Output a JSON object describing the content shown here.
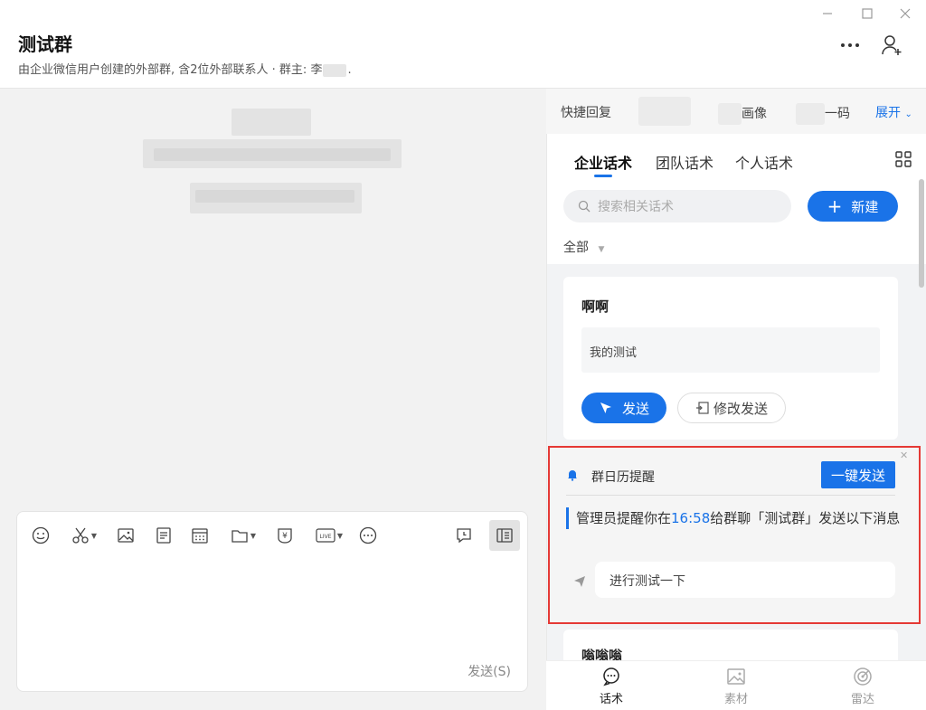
{
  "window": {
    "minimize_icon": "minimize-icon",
    "maximize_icon": "maximize-icon",
    "close_icon": "close-icon"
  },
  "header": {
    "title": "测试群",
    "subtitle_prefix": "由企业微信用户创建的外部群, 含2位外部联系人 · 群主: 李",
    "subtitle_suffix": ".",
    "more_icon": "more-icon",
    "add_member_icon": "add-member-icon"
  },
  "composer": {
    "send_hint": "发送(S)",
    "tools": [
      "emoji-icon",
      "scissors-icon",
      "image-icon",
      "document-icon",
      "calendar-icon",
      "folder-icon",
      "red-packet-icon",
      "live-icon",
      "more-icon",
      "chat-history-icon",
      "sidebar-panel-icon"
    ]
  },
  "quickbar": {
    "quick_reply": "快捷回复",
    "item2_suffix": "画像",
    "item3_suffix": "一码",
    "expand": "展开"
  },
  "panel": {
    "tabs": [
      "企业话术",
      "团队话术",
      "个人话术"
    ],
    "search_placeholder": "搜索相关话术",
    "new_button": "新建",
    "filter": "全部",
    "cards": [
      {
        "title": "啊啊",
        "body": "我的测试",
        "send": "发送",
        "edit": "修改发送"
      },
      {
        "title": "嗡嗡嗡"
      }
    ]
  },
  "reminder": {
    "title": "群日历提醒",
    "one_click_send": "一键发送",
    "msg_part1": "管理员提醒你在",
    "msg_time": "16:58",
    "msg_part2": "给群聊「测试群」发送以下消息",
    "quote": "进行测试一下"
  },
  "bottom_nav": [
    "话术",
    "素材",
    "雷达"
  ],
  "colors": {
    "accent": "#1a73e8",
    "highlight_border": "#e53935"
  }
}
